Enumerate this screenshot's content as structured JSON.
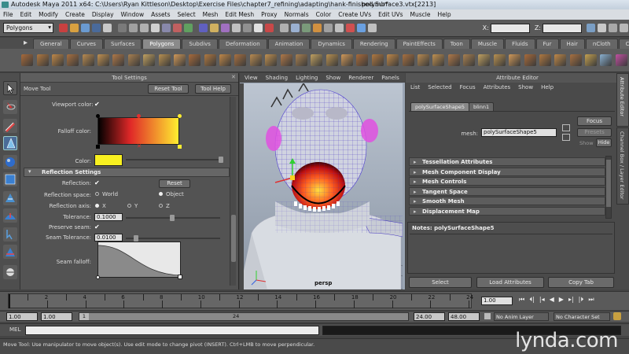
{
  "title_bar": {
    "title": "Autodesk Maya 2011 x64: C:\\Users\\Ryan Kittleson\\Desktop\\Exercise Files\\chapter7_refining\\adapting\\hank-finished.mb*",
    "selection": "polySurface3.vtx[2213]"
  },
  "menu_bar": {
    "items": [
      "File",
      "Edit",
      "Modify",
      "Create",
      "Display",
      "Window",
      "Assets",
      "Select",
      "Mesh",
      "Edit Mesh",
      "Proxy",
      "Normals",
      "Color",
      "Create UVs",
      "Edit UVs",
      "Muscle",
      "Help"
    ]
  },
  "status_line": {
    "mode": "Polygons",
    "x_label": "X:",
    "z_label": "Z:"
  },
  "shelf": {
    "tabs": [
      "General",
      "Curves",
      "Surfaces",
      "Polygons",
      "Subdivs",
      "Deformation",
      "Animation",
      "Dynamics",
      "Rendering",
      "PaintEffects",
      "Toon",
      "Muscle",
      "Fluids",
      "Fur",
      "Hair",
      "nCloth",
      "Custom"
    ],
    "active_tab": "Polygons",
    "icon_colors": [
      "#a86a3a",
      "#b07840",
      "#c08848",
      "#a87040",
      "#b88a50",
      "#c09050",
      "#b07848",
      "#a88050",
      "#c0a060",
      "#b89050",
      "#d09858",
      "#a86a3a",
      "#b07840",
      "#c08848",
      "#a87040",
      "#b88a50",
      "#c09050",
      "#b07848",
      "#a88050",
      "#c0a060",
      "#b89050",
      "#d09858",
      "#a86a3a",
      "#b07840",
      "#c08848",
      "#a87040",
      "#b88a50",
      "#c09050",
      "#b07848",
      "#a88050",
      "#c0a060",
      "#b89050",
      "#d09858",
      "#a86a3a",
      "#b07840",
      "#c08848",
      "#a87040",
      "#c4a050",
      "#8ab0d0",
      "#c050a0",
      "#e0e0e0",
      "#d0d0d0"
    ]
  },
  "tool_settings": {
    "header": "Tool Settings",
    "tool_name": "Move Tool",
    "reset_tool": "Reset Tool",
    "tool_help": "Tool Help",
    "viewport_color_label": "Viewport color:",
    "falloff_color_label": "Falloff color:",
    "color_label": "Color:",
    "color_value": "#f8f020",
    "reflection_section": "Reflection Settings",
    "reflection_label": "Reflection:",
    "reset_label": "Reset",
    "reflection_space_label": "Reflection space:",
    "world_option": "World",
    "object_option": "Object",
    "reflection_axis_label": "Reflection axis:",
    "axis_x": "X",
    "axis_y": "Y",
    "axis_z": "Z",
    "tolerance_label": "Tolerance:",
    "tolerance_value": "0.1000",
    "preserve_seam_label": "Preserve seam:",
    "seam_tolerance_label": "Seam Tolerance:",
    "seam_tolerance_value": "0.0100",
    "seam_falloff_label": "Seam falloff:"
  },
  "viewport": {
    "menu": [
      "View",
      "Shading",
      "Lighting",
      "Show",
      "Renderer",
      "Panels"
    ],
    "camera_label": "persp"
  },
  "attribute_editor": {
    "header": "Attribute Editor",
    "menu": [
      "List",
      "Selected",
      "Focus",
      "Attributes",
      "Show",
      "Help"
    ],
    "tabs": [
      "polySurfaceShape5",
      "blinn1"
    ],
    "mesh_label": "mesh:",
    "mesh_value": "polySurfaceShape5",
    "focus": "Focus",
    "presets": "Presets",
    "show": "Show",
    "hide": "Hide",
    "sections": [
      "Tessellation Attributes",
      "Mesh Component Display",
      "Mesh Controls",
      "Tangent Space",
      "Smooth Mesh",
      "Displacement Map"
    ],
    "notes": "Notes:  polySurfaceShape5",
    "select": "Select",
    "load_attributes": "Load Attributes",
    "copy_tab": "Copy Tab",
    "side_tabs": [
      "Attribute Editor",
      "Channel Box / Layer Editor"
    ]
  },
  "time_slider": {
    "ticks": [
      "2",
      "4",
      "6",
      "8",
      "10",
      "12",
      "14",
      "16",
      "18",
      "20",
      "22",
      "24"
    ],
    "current_frame": "1.00"
  },
  "range_slider": {
    "start": "1.00",
    "playback_start": "1.00",
    "range_start": "1",
    "range_end_marker": "24",
    "playback_end": "24.00",
    "end": "48.00",
    "anim_layer": "No Anim Layer",
    "character_set": "No Character Set"
  },
  "command_line": {
    "label": "MEL"
  },
  "help_line": {
    "text": "Move Tool: Use manipulator to move object(s). Use edit mode to change pivot (INSERT). Ctrl+LMB to move perpendicular."
  },
  "watermark": "lynda.com"
}
